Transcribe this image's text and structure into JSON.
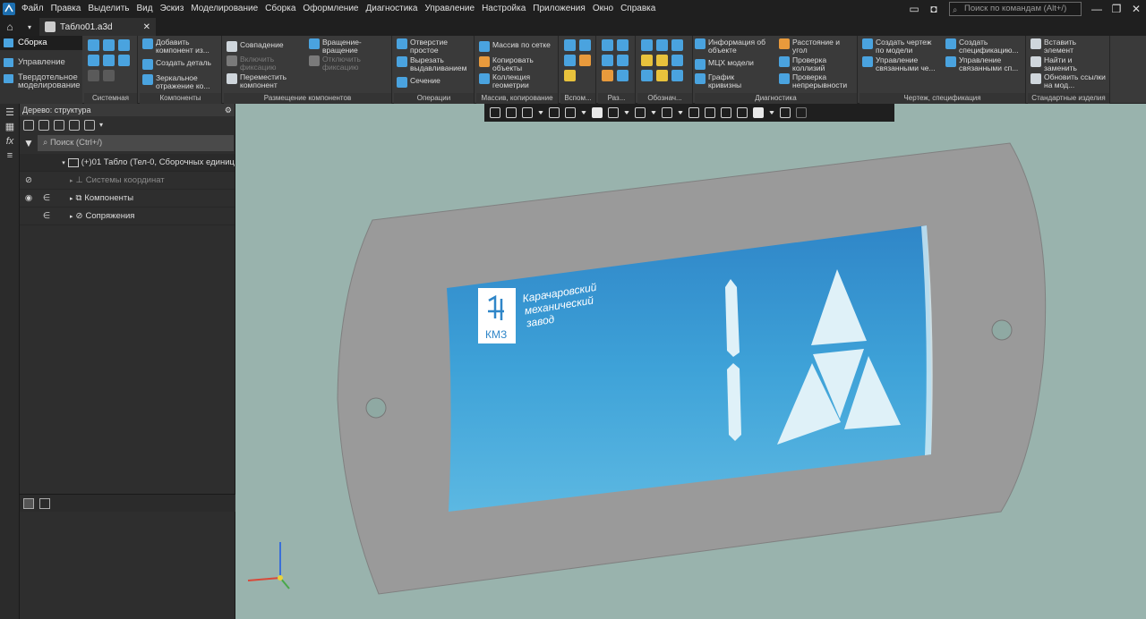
{
  "menubar": {
    "items": [
      "Файл",
      "Правка",
      "Выделить",
      "Вид",
      "Эскиз",
      "Моделирование",
      "Сборка",
      "Оформление",
      "Диагностика",
      "Управление",
      "Настройка",
      "Приложения",
      "Окно",
      "Справка"
    ],
    "search_placeholder": "Поиск по командам (Alt+/)"
  },
  "tabs": [
    {
      "label": "Табло01.a3d"
    }
  ],
  "modes": [
    "Сборка",
    "Управление",
    "Твердотельное моделирование"
  ],
  "ribbon": {
    "groups": {
      "system": "Системная",
      "components": "Компоненты",
      "placement": "Размещение компонентов",
      "operations": "Операции",
      "array": "Массив, копирование",
      "aux": "Вспом...",
      "sizes": "Раз...",
      "notes": "Обознач...",
      "diagnostics": "Диагностика",
      "drawing": "Чертеж, спецификация",
      "standard": "Стандартные изделия"
    },
    "buttons": {
      "add_component": "Добавить компонент из...",
      "create_part": "Создать деталь",
      "mirror": "Зеркальное отражение ко...",
      "coincidence": "Совпадение",
      "enable_fix": "Включить фиксацию",
      "move_component": "Переместить компонент",
      "rotate": "Вращение-вращение",
      "disable_fix": "Отключить фиксацию",
      "hole": "Отверстие простое",
      "extrude_cut": "Вырезать выдавливанием",
      "section": "Сечение",
      "grid_array": "Массив по сетке",
      "copy_objects": "Копировать объекты",
      "geometry_collection": "Коллекция геометрии",
      "object_info": "Информация об объекте",
      "mass_props": "МЦХ модели",
      "curvature": "График кривизны",
      "distance_angle": "Расстояние и угол",
      "collision_check": "Проверка коллизий",
      "continuity_check": "Проверка непрерывности",
      "create_drawing": "Создать чертеж по модели",
      "manage_linked": "Управление связанными че...",
      "create_spec": "Создать спецификацию...",
      "manage_linked_spec": "Управление связанными сп...",
      "insert_element": "Вставить элемент",
      "find_replace": "Найти и заменить",
      "update_links": "Обновить ссылки на мод..."
    }
  },
  "tree": {
    "title": "Дерево: структура",
    "search_placeholder": "Поиск (Ctrl+/)",
    "root": "(+)01 Табло (Тел-0, Сборочных единиц",
    "items": [
      "Системы координат",
      "Компоненты",
      "Сопряжения"
    ]
  },
  "model": {
    "company_line1": "Карачаровский",
    "company_line2": "механический",
    "company_line3": "завод",
    "logo_text": "КМЗ",
    "floor_number": "1"
  },
  "colors": {
    "panel_blue": "#2f9fd6",
    "viewport_bg": "#99b3ad",
    "frame_gray": "#9a9a9a"
  }
}
